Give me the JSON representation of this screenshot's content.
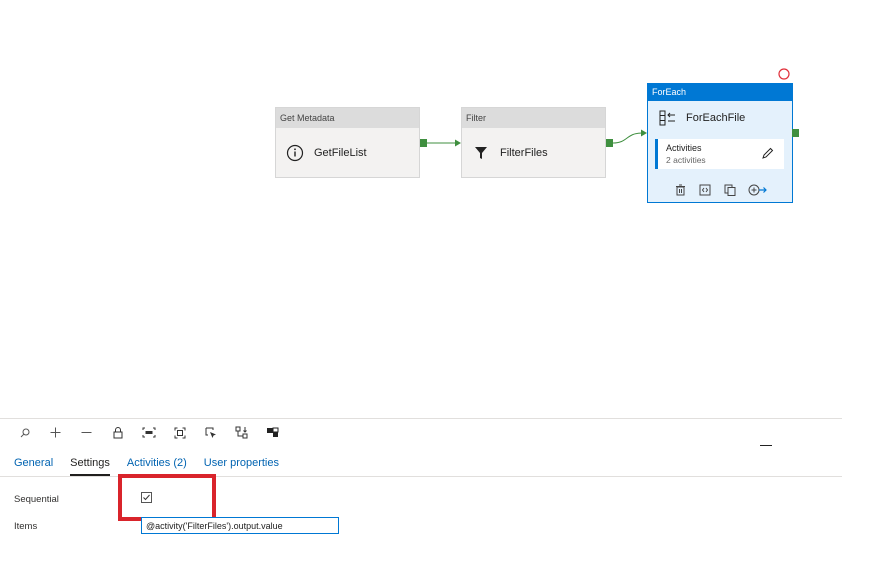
{
  "nodes": {
    "get_metadata": {
      "header": "Get Metadata",
      "name": "GetFileList",
      "icon": "info-icon"
    },
    "filter": {
      "header": "Filter",
      "name": "FilterFiles",
      "icon": "funnel-icon"
    },
    "foreach": {
      "header": "ForEach",
      "name": "ForEachFile",
      "icon": "foreach-icon",
      "activities_label": "Activities",
      "activities_count": "2 activities",
      "tools": [
        "delete-icon",
        "code-icon",
        "copy-icon",
        "add-output-icon"
      ]
    }
  },
  "toolbar": {
    "icons": [
      "search-icon",
      "zoom-in-icon",
      "zoom-out-icon",
      "lock-icon",
      "zoom-100-icon",
      "fit-to-screen-icon",
      "select-icon",
      "auto-align-icon",
      "minimap-icon"
    ]
  },
  "tabs": [
    {
      "label": "General"
    },
    {
      "label": "Settings"
    },
    {
      "label": "Activities (2)"
    },
    {
      "label": "User properties"
    }
  ],
  "settings": {
    "sequential_label": "Sequential",
    "sequential_checked": true,
    "items_label": "Items",
    "items_value": "@activity('FilterFiles').output.value"
  },
  "colors": {
    "accent": "#0078d4",
    "port": "#3f8f3f",
    "highlight": "#d9242b"
  }
}
